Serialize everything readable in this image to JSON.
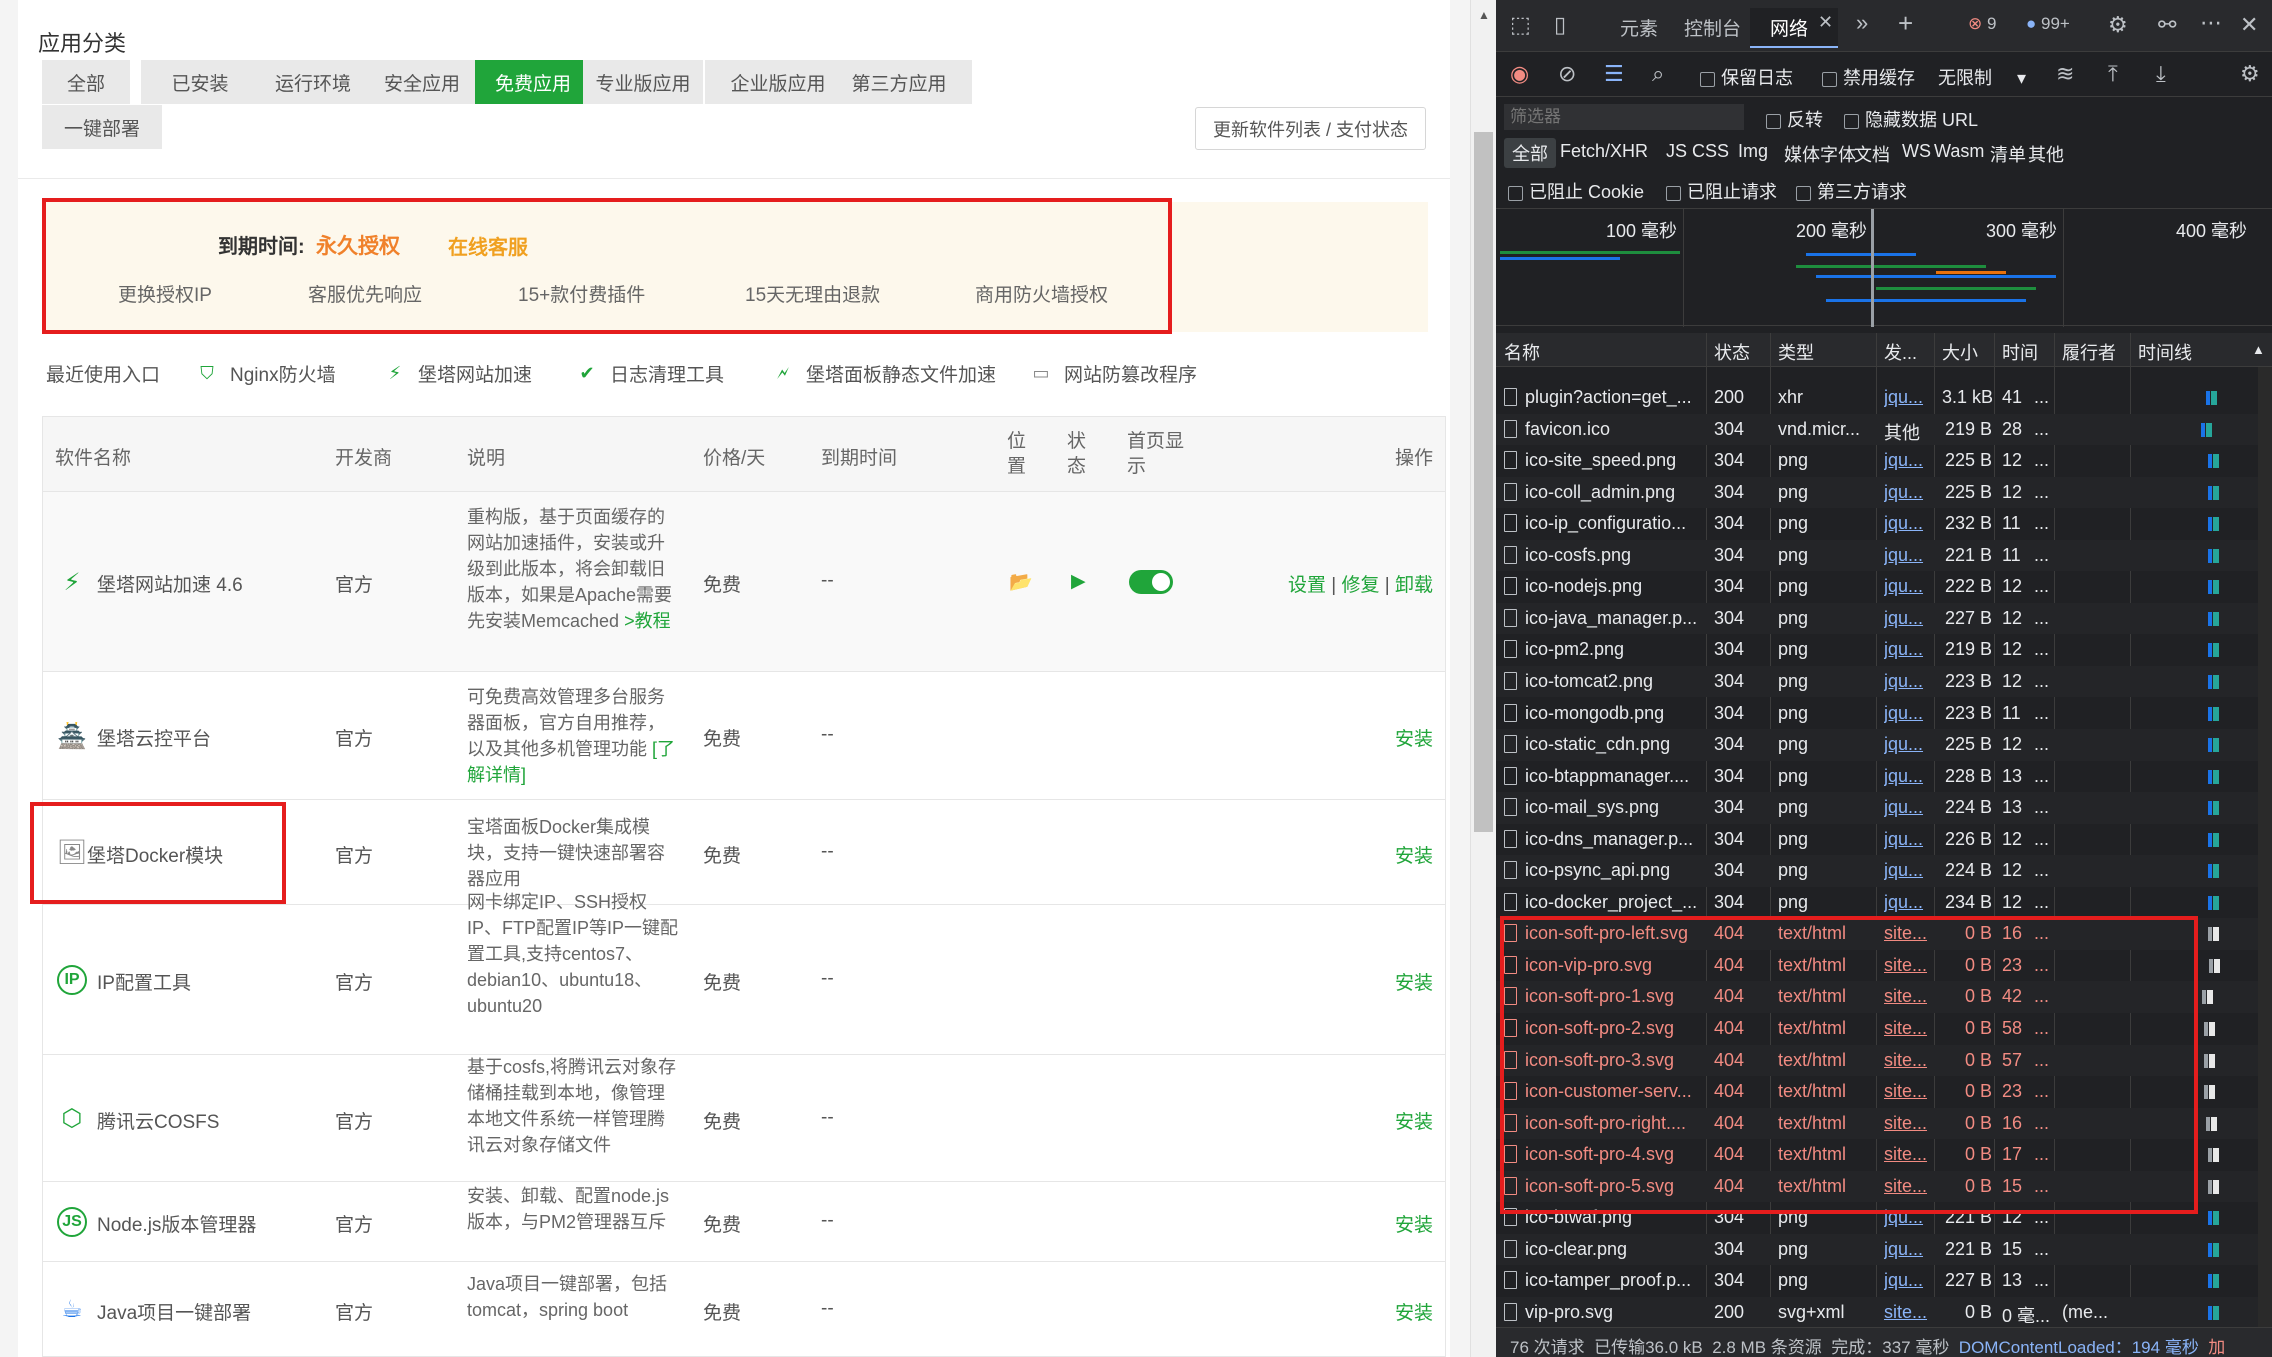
{
  "store": {
    "category_title": "应用分类",
    "categories": [
      "全部",
      "已安装",
      "运行环境",
      "安全应用",
      "免费应用",
      "专业版应用",
      "企业版应用",
      "第三方应用",
      "一键部署"
    ],
    "active_category": "免费应用",
    "update_button": "更新软件列表 / 支付状态",
    "license": {
      "expire_label": "到期时间:",
      "expire_value": "永久授权",
      "online_service": "在线客服",
      "features": [
        "更换授权IP",
        "客服优先响应",
        "15+款付费插件",
        "15天无理由退款",
        "商用防火墙授权"
      ]
    },
    "recent": {
      "label": "最近使用入口",
      "items": [
        "Nginx防火墙",
        "堡塔网站加速",
        "日志清理工具",
        "堡塔面板静态文件加速",
        "网站防篡改程序"
      ]
    },
    "columns": {
      "name": "软件名称",
      "developer": "开发商",
      "desc": "说明",
      "price": "价格/天",
      "expire": "到期时间",
      "location": "位置",
      "status": "状态",
      "homepage": "首页显示",
      "action": "操作"
    },
    "rows": [
      {
        "name": "堡塔网站加速 4.6",
        "developer": "官方",
        "desc": "重构版，基于页面缓存的网站加速插件，安装或升级到此版本，将会卸载旧版本，如果是Apache需要先安装Memcached",
        "desc_link": ">教程",
        "price": "免费",
        "expire": "--",
        "actions": [
          "设置",
          "修复",
          "卸载"
        ]
      },
      {
        "name": "堡塔云控平台",
        "developer": "官方",
        "desc": "可免费高效管理多台服务器面板，官方自用推荐，以及其他多机管理功能",
        "desc_link": "[了解详情]",
        "price": "免费",
        "expire": "--",
        "actions": [
          "安装"
        ]
      },
      {
        "name": "堡塔Docker模块",
        "developer": "官方",
        "desc": "宝塔面板Docker集成模块，支持一键快速部署容器应用",
        "desc_link": "",
        "price": "免费",
        "expire": "--",
        "actions": [
          "安装"
        ]
      },
      {
        "name": "IP配置工具",
        "developer": "官方",
        "desc": "网卡绑定IP、SSH授权IP、FTP配置IP等IP一键配置工具,支持centos7、debian10、ubuntu18、ubuntu20",
        "desc_link": "",
        "price": "免费",
        "expire": "--",
        "actions": [
          "安装"
        ]
      },
      {
        "name": "腾讯云COSFS",
        "developer": "官方",
        "desc": "基于cosfs,将腾讯云对象存储桶挂载到本地，像管理本地文件系统一样管理腾讯云对象存储文件",
        "desc_link": "",
        "price": "免费",
        "expire": "--",
        "actions": [
          "安装"
        ]
      },
      {
        "name": "Node.js版本管理器",
        "developer": "官方",
        "desc": "安装、卸载、配置node.js版本，与PM2管理器互斥",
        "desc_link": "",
        "price": "免费",
        "expire": "--",
        "actions": [
          "安装"
        ]
      },
      {
        "name": "Java项目一键部署",
        "developer": "官方",
        "desc": "Java项目一键部署，包括tomcat，spring boot",
        "desc_link": "",
        "price": "免费",
        "expire": "--",
        "actions": [
          "安装"
        ]
      }
    ]
  },
  "devtools": {
    "tabs": [
      "元素",
      "控制台",
      "网络"
    ],
    "active_tab": "网络",
    "error_count": "9",
    "info_count": "99+",
    "toolbar": {
      "preserve_log": "保留日志",
      "disable_cache": "禁用缓存",
      "throttle": "无限制"
    },
    "filter": {
      "placeholder": "筛选器",
      "invert": "反转",
      "hide_data_urls": "隐藏数据 URL"
    },
    "types": [
      "全部",
      "Fetch/XHR",
      "JS",
      "CSS",
      "Img",
      "媒体",
      "字体",
      "文档",
      "WS",
      "Wasm",
      "清单",
      "其他"
    ],
    "options": [
      "已阻止 Cookie",
      "已阻止请求",
      "第三方请求"
    ],
    "overview_ticks": [
      "100 毫秒",
      "200 毫秒",
      "300 毫秒",
      "400 毫秒"
    ],
    "headers": [
      "名称",
      "状态",
      "类型",
      "发...",
      "大小",
      "时间",
      "履行者",
      "时间线"
    ],
    "requests": [
      {
        "name": "plugin?action=get_...",
        "status": "200",
        "type": "xhr",
        "initiator": "jqu...",
        "size": "3.1 kB",
        "time": "41",
        "perf": "...",
        "err": false,
        "link": true
      },
      {
        "name": "favicon.ico",
        "status": "304",
        "type": "vnd.micr...",
        "initiator": "其他",
        "size": "219 B",
        "time": "28",
        "perf": "...",
        "err": false,
        "link": false
      },
      {
        "name": "ico-site_speed.png",
        "status": "304",
        "type": "png",
        "initiator": "jqu...",
        "size": "225 B",
        "time": "12",
        "perf": "...",
        "err": false,
        "link": true
      },
      {
        "name": "ico-coll_admin.png",
        "status": "304",
        "type": "png",
        "initiator": "jqu...",
        "size": "225 B",
        "time": "12",
        "perf": "...",
        "err": false,
        "link": true
      },
      {
        "name": "ico-ip_configuratio...",
        "status": "304",
        "type": "png",
        "initiator": "jqu...",
        "size": "232 B",
        "time": "11",
        "perf": "...",
        "err": false,
        "link": true
      },
      {
        "name": "ico-cosfs.png",
        "status": "304",
        "type": "png",
        "initiator": "jqu...",
        "size": "221 B",
        "time": "11",
        "perf": "...",
        "err": false,
        "link": true
      },
      {
        "name": "ico-nodejs.png",
        "status": "304",
        "type": "png",
        "initiator": "jqu...",
        "size": "222 B",
        "time": "12",
        "perf": "...",
        "err": false,
        "link": true
      },
      {
        "name": "ico-java_manager.p...",
        "status": "304",
        "type": "png",
        "initiator": "jqu...",
        "size": "227 B",
        "time": "12",
        "perf": "...",
        "err": false,
        "link": true
      },
      {
        "name": "ico-pm2.png",
        "status": "304",
        "type": "png",
        "initiator": "jqu...",
        "size": "219 B",
        "time": "12",
        "perf": "...",
        "err": false,
        "link": true
      },
      {
        "name": "ico-tomcat2.png",
        "status": "304",
        "type": "png",
        "initiator": "jqu...",
        "size": "223 B",
        "time": "12",
        "perf": "...",
        "err": false,
        "link": true
      },
      {
        "name": "ico-mongodb.png",
        "status": "304",
        "type": "png",
        "initiator": "jqu...",
        "size": "223 B",
        "time": "11",
        "perf": "...",
        "err": false,
        "link": true
      },
      {
        "name": "ico-static_cdn.png",
        "status": "304",
        "type": "png",
        "initiator": "jqu...",
        "size": "225 B",
        "time": "12",
        "perf": "...",
        "err": false,
        "link": true
      },
      {
        "name": "ico-btappmanager....",
        "status": "304",
        "type": "png",
        "initiator": "jqu...",
        "size": "228 B",
        "time": "13",
        "perf": "...",
        "err": false,
        "link": true
      },
      {
        "name": "ico-mail_sys.png",
        "status": "304",
        "type": "png",
        "initiator": "jqu...",
        "size": "224 B",
        "time": "13",
        "perf": "...",
        "err": false,
        "link": true
      },
      {
        "name": "ico-dns_manager.p...",
        "status": "304",
        "type": "png",
        "initiator": "jqu...",
        "size": "226 B",
        "time": "12",
        "perf": "...",
        "err": false,
        "link": true
      },
      {
        "name": "ico-psync_api.png",
        "status": "304",
        "type": "png",
        "initiator": "jqu...",
        "size": "224 B",
        "time": "12",
        "perf": "...",
        "err": false,
        "link": true
      },
      {
        "name": "ico-docker_project_...",
        "status": "304",
        "type": "png",
        "initiator": "jqu...",
        "size": "234 B",
        "time": "12",
        "perf": "...",
        "err": false,
        "link": true
      },
      {
        "name": "icon-soft-pro-left.svg",
        "status": "404",
        "type": "text/html",
        "initiator": "site...",
        "size": "0 B",
        "time": "16",
        "perf": "...",
        "err": true,
        "link": true
      },
      {
        "name": "icon-vip-pro.svg",
        "status": "404",
        "type": "text/html",
        "initiator": "site...",
        "size": "0 B",
        "time": "23",
        "perf": "...",
        "err": true,
        "link": true
      },
      {
        "name": "icon-soft-pro-1.svg",
        "status": "404",
        "type": "text/html",
        "initiator": "site...",
        "size": "0 B",
        "time": "42",
        "perf": "...",
        "err": true,
        "link": true
      },
      {
        "name": "icon-soft-pro-2.svg",
        "status": "404",
        "type": "text/html",
        "initiator": "site...",
        "size": "0 B",
        "time": "58",
        "perf": "...",
        "err": true,
        "link": true
      },
      {
        "name": "icon-soft-pro-3.svg",
        "status": "404",
        "type": "text/html",
        "initiator": "site...",
        "size": "0 B",
        "time": "57",
        "perf": "...",
        "err": true,
        "link": true
      },
      {
        "name": "icon-customer-serv...",
        "status": "404",
        "type": "text/html",
        "initiator": "site...",
        "size": "0 B",
        "time": "23",
        "perf": "...",
        "err": true,
        "link": true
      },
      {
        "name": "icon-soft-pro-right....",
        "status": "404",
        "type": "text/html",
        "initiator": "site...",
        "size": "0 B",
        "time": "16",
        "perf": "...",
        "err": true,
        "link": true
      },
      {
        "name": "icon-soft-pro-4.svg",
        "status": "404",
        "type": "text/html",
        "initiator": "site...",
        "size": "0 B",
        "time": "17",
        "perf": "...",
        "err": true,
        "link": true
      },
      {
        "name": "icon-soft-pro-5.svg",
        "status": "404",
        "type": "text/html",
        "initiator": "site...",
        "size": "0 B",
        "time": "15",
        "perf": "...",
        "err": true,
        "link": true
      },
      {
        "name": "ico-btwaf.png",
        "status": "304",
        "type": "png",
        "initiator": "jqu...",
        "size": "221 B",
        "time": "12",
        "perf": "...",
        "err": false,
        "link": true
      },
      {
        "name": "ico-clear.png",
        "status": "304",
        "type": "png",
        "initiator": "jqu...",
        "size": "221 B",
        "time": "15",
        "perf": "...",
        "err": false,
        "link": true
      },
      {
        "name": "ico-tamper_proof.p...",
        "status": "304",
        "type": "png",
        "initiator": "jqu...",
        "size": "227 B",
        "time": "13",
        "perf": "...",
        "err": false,
        "link": true
      },
      {
        "name": "vip-pro.svg",
        "status": "200",
        "type": "svg+xml",
        "initiator": "site...",
        "size": "0 B",
        "time": "0 毫...",
        "perf": "(me...",
        "err": false,
        "link": true
      }
    ],
    "status_bar": {
      "requests": "76 次请求",
      "transferred": "已传输36.0 kB",
      "resources": "2.8 MB 条资源",
      "finish": "完成：337 毫秒",
      "dcl": "DOMContentLoaded：194 毫秒",
      "load": "加"
    }
  },
  "colors": {
    "accent": "#20a53a",
    "error_red": "#e51d1d",
    "license_orange": "#f0812b"
  }
}
